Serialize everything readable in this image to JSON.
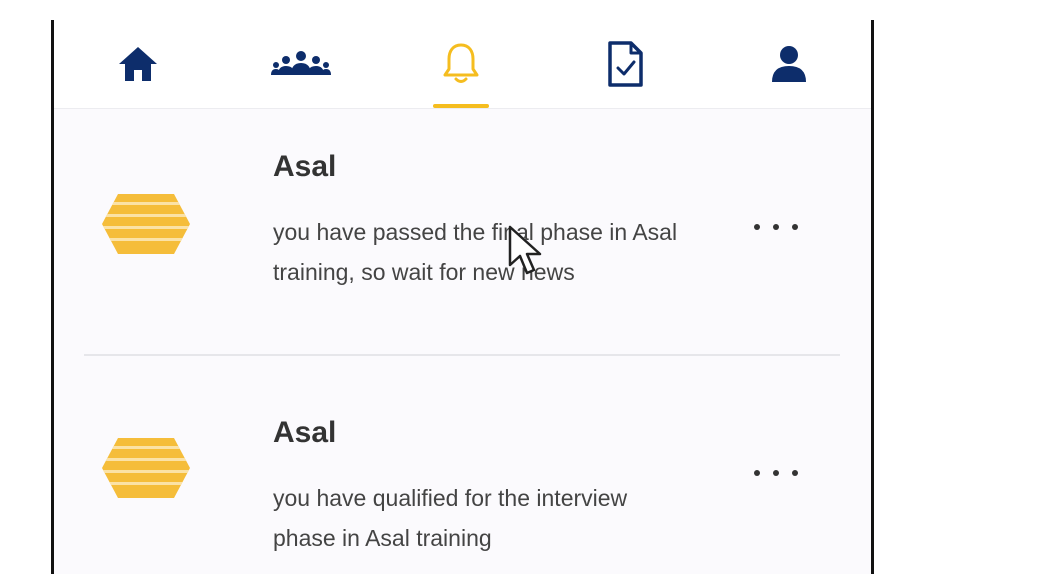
{
  "nav": {
    "items": [
      {
        "icon": "home-icon",
        "active": false
      },
      {
        "icon": "group-icon",
        "active": false
      },
      {
        "icon": "bell-icon",
        "active": true
      },
      {
        "icon": "document-check-icon",
        "active": false
      },
      {
        "icon": "user-icon",
        "active": false
      }
    ],
    "colors": {
      "icon": "#0d2d6b",
      "active": "#f5bd1f"
    }
  },
  "notifications": [
    {
      "title": "Asal",
      "body": "you have passed the final phase in Asal training, so wait for new news",
      "logo": "asal-logo",
      "menu_icon": "more-icon"
    },
    {
      "title": "Asal",
      "body": "you have qualified for the interview phase in Asal training",
      "logo": "asal-logo",
      "menu_icon": "more-icon"
    }
  ],
  "brand_color": "#f5bd1f"
}
